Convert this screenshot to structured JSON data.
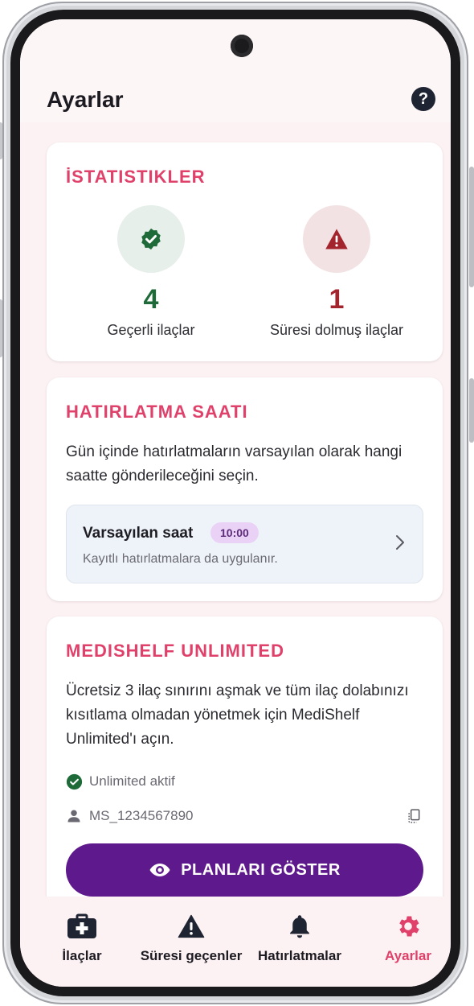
{
  "header": {
    "title": "Ayarlar",
    "help_glyph": "?"
  },
  "stats": {
    "title": "İSTATISTIKLER",
    "valid": {
      "value": "4",
      "label": "Geçerli ilaçlar",
      "color": "#1e6b39"
    },
    "expired": {
      "value": "1",
      "label": "Süresi dolmuş ilaçlar",
      "color": "#a3242c"
    }
  },
  "reminder": {
    "title": "HATIRLATMA SAATI",
    "description": "Gün içinde hatırlatmaların varsayılan olarak hangi saatte gönderileceğini seçin.",
    "default_label": "Varsayılan saat",
    "default_time": "10:00",
    "subtitle": "Kayıtlı hatırlatmalara da uygulanır."
  },
  "unlimited": {
    "title": "MEDISHELF UNLIMITED",
    "description": "Ücretsiz 3 ilaç sınırını aşmak ve tüm ilaç dolabınızı kısıtlama olmadan yönetmek için MediShelf Unlimited'ı açın.",
    "status": "Unlimited aktif",
    "user_id": "MS_1234567890",
    "button_label": "PLANLARI GÖSTER"
  },
  "nav": {
    "items": [
      {
        "label": "İlaçlar",
        "icon": "medical-kit-icon"
      },
      {
        "label": "Süresi geçenler",
        "icon": "warning-icon"
      },
      {
        "label": "Hatırlatmalar",
        "icon": "bell-icon"
      },
      {
        "label": "Ayarlar",
        "icon": "gear-icon",
        "active": true
      }
    ],
    "active_color": "#e0416a"
  },
  "colors": {
    "accent": "#e0416a",
    "primary_button": "#5e1a8c",
    "background": "#fdf2f3"
  }
}
